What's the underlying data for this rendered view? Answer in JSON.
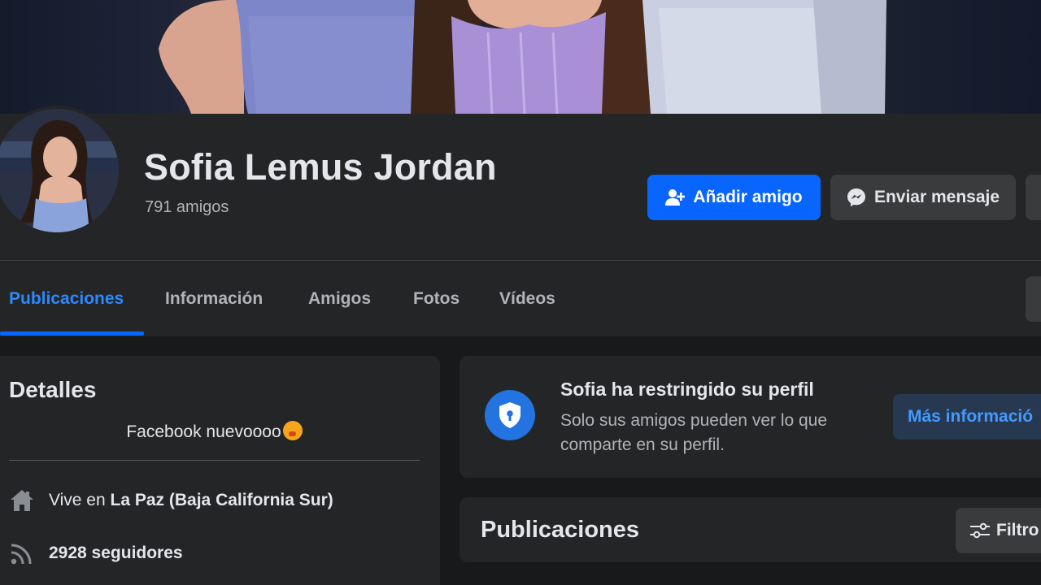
{
  "colors": {
    "accent": "#0866ff",
    "link_blue": "#2d88ff",
    "background": "#18191a",
    "surface": "#242526",
    "secondary_button": "#3a3b3c",
    "text_primary": "#e4e6eb",
    "text_secondary": "#b0b3b8"
  },
  "profile": {
    "name": "Sofia Lemus Jordan",
    "friends_count": "791 amigos"
  },
  "actions": {
    "add_friend": {
      "label": "Añadir amigo",
      "icon": "add-friend-icon"
    },
    "send_message": {
      "label": "Enviar mensaje",
      "icon": "messenger-icon"
    }
  },
  "tabs": [
    {
      "label": "Publicaciones",
      "active": true
    },
    {
      "label": "Información",
      "active": false
    },
    {
      "label": "Amigos",
      "active": false
    },
    {
      "label": "Fotos",
      "active": false
    },
    {
      "label": "Vídeos",
      "active": false
    }
  ],
  "details": {
    "title": "Detalles",
    "bio": "Facebook nuevoooo",
    "bio_emoji": "face-emoji",
    "lives_in_prefix": "Vive en",
    "lives_in_place": "La Paz (Baja California Sur)",
    "followers": "2928 seguidores"
  },
  "restricted": {
    "title": "Sofia ha restringido su perfil",
    "line1": "Solo sus amigos pueden ver lo que",
    "line2": "comparte en su perfil.",
    "button": "Más informació",
    "icon": "shield-lock-icon"
  },
  "posts": {
    "title": "Publicaciones",
    "filter_button": "Filtro",
    "filter_icon": "sliders-icon"
  }
}
